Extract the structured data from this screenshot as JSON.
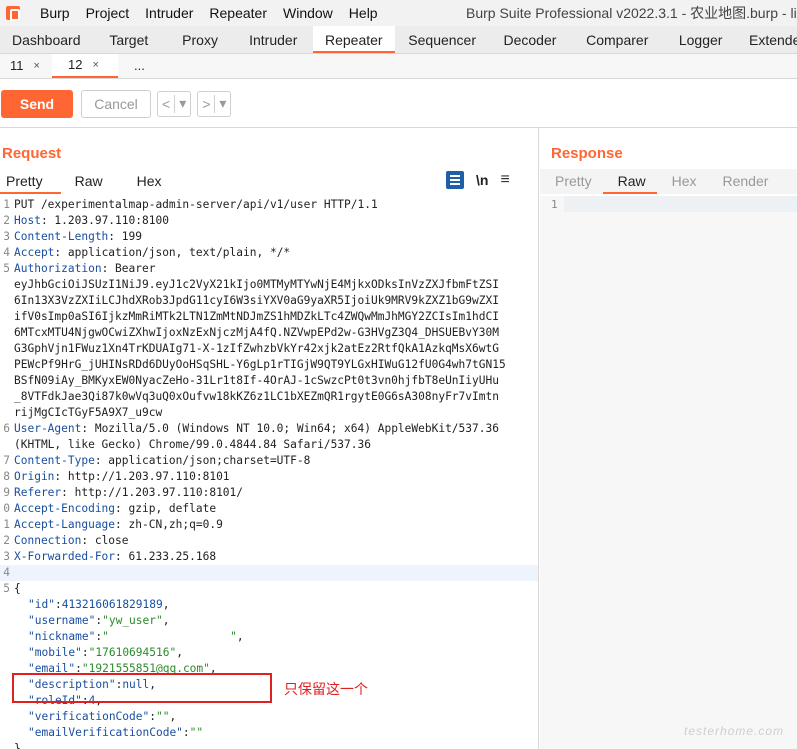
{
  "menubar": {
    "items": [
      "Burp",
      "Project",
      "Intruder",
      "Repeater",
      "Window",
      "Help"
    ],
    "window_title": "Burp Suite Professional v2022.3.1 - 农业地图.burp - lic"
  },
  "main_tabs": [
    "Dashboard",
    "Target",
    "Proxy",
    "Intruder",
    "Repeater",
    "Sequencer",
    "Decoder",
    "Comparer",
    "Logger",
    "Extende"
  ],
  "active_main_tab": "Repeater",
  "sub_tabs": {
    "tab1": "11",
    "tab2": "12",
    "more": "...",
    "close": "×"
  },
  "toolbar": {
    "send": "Send",
    "cancel": "Cancel",
    "back": "<",
    "forward": ">",
    "dropdown": "▾"
  },
  "request": {
    "title": "Request",
    "tabs": [
      "Pretty",
      "Raw",
      "Hex"
    ],
    "newline_icon": "\\n",
    "menu_icon": "≡",
    "lines": [
      {
        "n": "1",
        "key": "",
        "val": "PUT /experimentalmap-admin-server/api/v1/user HTTP/1.1"
      },
      {
        "n": "2",
        "key": "Host",
        "val": ": 1.203.97.110:8100"
      },
      {
        "n": "3",
        "key": "Content-Length",
        "val": ": 199"
      },
      {
        "n": "4",
        "key": "Accept",
        "val": ": application/json, text/plain, */*"
      },
      {
        "n": "5",
        "key": "Authorization",
        "val": ": Bearer"
      }
    ],
    "auth_continuation": [
      "eyJhbGciOiJSUzI1NiJ9.eyJ1c2VyX21kIjo0MTMyMTYwNjE4MjkxODksInVzZXJfbmFtZSI",
      "6In13X3VzZXIiLCJhdXRob3JpdG11cyI6W3siYXV0aG9yaXR5IjoiUk9MRV9kZXZ1bG9wZXI",
      "ifV0sImp0aSI6IjkzMmRiMTk2LTN1ZmMtNDJmZS1hMDZkLTc4ZWQwMmJhMGY2ZCIsIm1hdCI",
      "6MTcxMTU4NjgwOCwiZXhwIjoxNzExNjczMjA4fQ.NZVwpEPd2w-G3HVgZ3Q4_DHSUEBvY30M",
      "G3GphVjn1FWuz1Xn4TrKDUAIg71-X-1zIfZwhzbVkYr42xjk2atEz2RtfQkA1AzkqMsX6wtG",
      "PEWcPf9HrG_jUHINsRDd6DUyOoHSqSHL-Y6gLp1rTIGjW9QT9YLGxHIWuG12fU0G4wh7tGN15",
      "BSfN09iAy_BMKyxEW0NyacZeHo-31Lr1t8If-4OrAJ-1cSwzcPt0t3vn0hjfbT8eUnIiyUHu",
      "_8VTFdkJae3Qi87k0wVq3uQ0xOufvw18kKZ6z1LC1bXEZmQR1rgytE0G6sA308nyFr7vImtn",
      "rijMgCIcTGyF5A9X7_u9cw"
    ],
    "ua_line": {
      "n": "6",
      "key": "User-Agent",
      "val": ": Mozilla/5.0 (Windows NT 10.0; Win64; x64) AppleWebKit/537.36"
    },
    "ua_continuation": "(KHTML, like Gecko) Chrome/99.0.4844.84 Safari/537.36",
    "lines2": [
      {
        "n": "7",
        "key": "Content-Type",
        "val": ": application/json;charset=UTF-8"
      },
      {
        "n": "8",
        "key": "Origin",
        "val": ": http://1.203.97.110:8101"
      },
      {
        "n": "9",
        "key": "Referer",
        "val": ": http://1.203.97.110:8101/"
      },
      {
        "n": "0",
        "key": "Accept-Encoding",
        "val": ": gzip, deflate"
      },
      {
        "n": "1",
        "key": "Accept-Language",
        "val": ": zh-CN,zh;q=0.9"
      },
      {
        "n": "2",
        "key": "Connection",
        "val": ": close"
      },
      {
        "n": "3",
        "key": "X-Forwarded-For",
        "val": ": 61.233.25.168"
      },
      {
        "n": "4",
        "key": "",
        "val": ""
      },
      {
        "n": "5",
        "key": "",
        "val": "{"
      }
    ],
    "json_lines": [
      {
        "key": "\"id\"",
        "sep": ":",
        "val": "413216061829189",
        "type": "num",
        "tail": ","
      },
      {
        "key": "\"username\"",
        "sep": ":",
        "val": "\"yw_user\"",
        "type": "str",
        "tail": ","
      },
      {
        "key": "\"nickname\"",
        "sep": ":",
        "val": "\"                  \"",
        "type": "str",
        "tail": ","
      },
      {
        "key": "\"mobile\"",
        "sep": ":",
        "val": "\"17610694516\"",
        "type": "str",
        "tail": ","
      },
      {
        "key": "\"email\"",
        "sep": ":",
        "val": "\"1921555851@qq.com\"",
        "type": "str",
        "tail": ","
      },
      {
        "key": "\"description\"",
        "sep": ":",
        "val": "null",
        "type": "num",
        "tail": ","
      },
      {
        "key": "\"roleId\"",
        "sep": ":",
        "val": "4",
        "type": "num",
        "tail": ","
      },
      {
        "key": "\"verificationCode\"",
        "sep": ":",
        "val": "\"\"",
        "type": "str",
        "tail": ","
      },
      {
        "key": "\"emailVerificationCode\"",
        "sep": ":",
        "val": "\"\"",
        "type": "str",
        "tail": ""
      }
    ],
    "closing_brace": "}"
  },
  "annotation": {
    "text": "只保留这一个",
    "color": "#e02020"
  },
  "response": {
    "title": "Response",
    "tabs": [
      "Pretty",
      "Raw",
      "Hex",
      "Render"
    ],
    "active_tab": "Raw",
    "line_number": "1"
  },
  "watermark": "testerhome.com",
  "colors": {
    "accent": "#ff6633",
    "header_key": "#1a4fa0",
    "json_string": "#2c8a2c"
  }
}
